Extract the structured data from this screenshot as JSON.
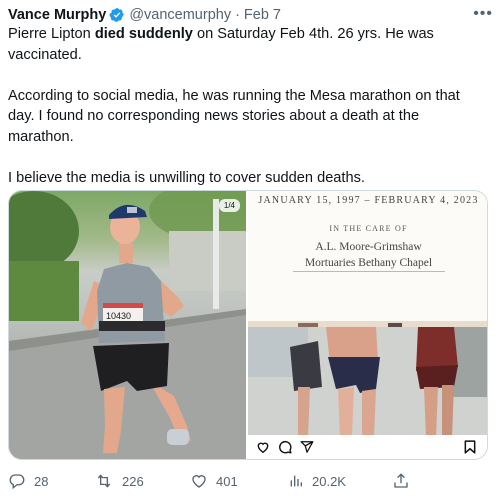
{
  "tweet": {
    "author": {
      "name": "Vance Murphy",
      "handle": "@vancemurphy",
      "date": "Feb 7",
      "separator": "·",
      "verified": true
    },
    "more_icon": "more-icon",
    "text": {
      "line1_pre": "Pierre Lipton ",
      "line1_bold": "died suddenly",
      "line1_post": " on Saturday Feb 4th. 26 yrs. He was vaccinated.",
      "paragraph2": "According to social media, he was running the Mesa marathon on that day. I found no corresponding news stories about a death at the marathon.",
      "paragraph3": "I believe the media is unwilling to cover sudden deaths."
    },
    "media": {
      "counter": "1/4",
      "bib_number": "10430",
      "memorial": {
        "dates": "JANUARY 15, 1997 – FEBRUARY 4, 2023",
        "care_label": "IN THE CARE OF",
        "funeral_home_line1": "A.L. Moore-Grimshaw",
        "funeral_home_line2": "Mortuaries Bethany Chapel"
      }
    },
    "actions": {
      "replies": "28",
      "retweets": "226",
      "likes": "401",
      "views": "20.2K"
    },
    "colors": {
      "text": "#0f1419",
      "secondary": "#536471",
      "verified": "#1d9bf0",
      "border": "#cfd9de"
    }
  }
}
